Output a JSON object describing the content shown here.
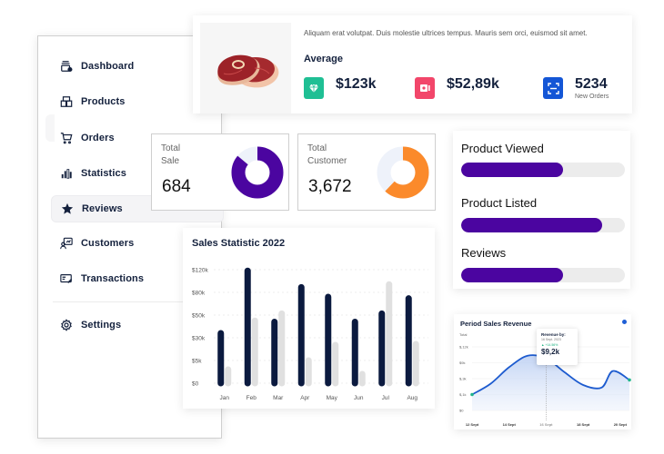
{
  "sidebar": {
    "items": [
      {
        "label": "Dashboard",
        "icon": "dashboard-icon"
      },
      {
        "label": "Products",
        "icon": "products-icon"
      },
      {
        "label": "Orders",
        "icon": "cart-icon"
      },
      {
        "label": "Statistics",
        "icon": "bar-chart-icon"
      },
      {
        "label": "Reviews",
        "icon": "star-icon",
        "active": true
      },
      {
        "label": "Customers",
        "icon": "customers-icon"
      },
      {
        "label": "Transactions",
        "icon": "transactions-icon"
      },
      {
        "label": "Settings",
        "icon": "gear-icon"
      }
    ]
  },
  "summary": {
    "description": "Aliquam erat volutpat. Duis molestie ultrices tempus. Mauris sem orci, euismod sit amet.",
    "title": "Average",
    "stats": [
      {
        "value": "$123k",
        "icon": "diamond-icon",
        "color": "#1fbf94"
      },
      {
        "value": "$52,89k",
        "icon": "ticket-icon",
        "color": "#f2466a"
      },
      {
        "value": "5234",
        "sublabel": "New Orders",
        "icon": "scan-icon",
        "color": "#1456d6"
      }
    ]
  },
  "totals": {
    "sale": {
      "label_line1": "Total",
      "label_line2": "Sale",
      "value": "684",
      "fraction": 0.86,
      "color": "#4b05a0"
    },
    "customer": {
      "label_line1": "Total",
      "label_line2": "Customer",
      "value": "3,672",
      "fraction": 0.62,
      "color": "#fb8a2b"
    }
  },
  "progress": [
    {
      "label": "Product Viewed",
      "fraction": 0.62
    },
    {
      "label": "Product Listed",
      "fraction": 0.86
    },
    {
      "label": "Reviews",
      "fraction": 0.62
    }
  ],
  "chart_data": [
    {
      "type": "bar",
      "title": "Sales Statistic 2022",
      "categories": [
        "Jan",
        "Feb",
        "Mar",
        "Apr",
        "May",
        "Jun",
        "Jul",
        "Aug"
      ],
      "ytick_labels": [
        "$0",
        "$5k",
        "$30k",
        "$50k",
        "$80k",
        "$120k"
      ],
      "ytick_values": [
        0,
        5,
        30,
        50,
        80,
        120
      ],
      "ylim": [
        0,
        120
      ],
      "grid": true,
      "series": [
        {
          "name": "primary",
          "color": "#0b1a3f",
          "values": [
            34,
            118,
            44,
            89,
            74,
            44,
            52,
            72
          ]
        },
        {
          "name": "secondary",
          "color": "#e0e0e0",
          "values": [
            3,
            45,
            52,
            5,
            22,
            2,
            94,
            23
          ]
        }
      ],
      "xlabel": "",
      "ylabel": ""
    },
    {
      "type": "area",
      "title": "Period Sales Revenue",
      "ylabel": "Total",
      "ytick_labels": [
        "$0",
        "$,1k",
        "$,3k",
        "$9k",
        "$,12k"
      ],
      "x_labels": [
        "12 Sept",
        "14 Sept",
        "16 Sept",
        "18 Sept",
        "20 Sept"
      ],
      "x": [
        12,
        13,
        14,
        15,
        16,
        17,
        18,
        19,
        19.6,
        20.5
      ],
      "values": [
        0.25,
        0.42,
        0.68,
        0.86,
        0.82,
        0.6,
        0.4,
        0.36,
        0.62,
        0.48
      ],
      "grid": true,
      "line_color": "#1d5bcf",
      "tooltip": {
        "title": "Revenue by:",
        "date": "16 Sept. 2023",
        "change": "+14.56%",
        "value": "$9,2k"
      }
    }
  ]
}
